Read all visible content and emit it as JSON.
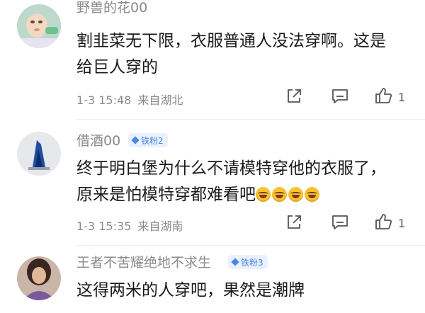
{
  "comments": [
    {
      "username": "野兽的花00",
      "badge": "",
      "line1": "割韭菜无下限，衣服普通人没法穿啊。这是",
      "line2": "给巨人穿的",
      "date": "1-3 15:48",
      "location": "来自湖北",
      "likes": "1"
    },
    {
      "username": "借酒00",
      "badge": "铁粉2",
      "line1": "终于明白堡为什么不请模特穿他的衣服了，",
      "line2": "原来是怕模特穿都难看吧",
      "emoji": [
        "laugh-cry-emoji",
        "laugh-cry-emoji",
        "laugh-cry-emoji",
        "laugh-cry-emoji"
      ],
      "date": "1-3 15:35",
      "location": "来自湖南",
      "likes": "1"
    },
    {
      "username": "王者不苦耀绝地不求生",
      "badge": "铁粉3",
      "line1": "这得两米的人穿吧，果然是潮牌"
    }
  ],
  "icons": {
    "share": "share-icon",
    "reply": "comment-icon",
    "like": "thumbs-up-icon"
  },
  "colors": {
    "badge_bg": "#eaf1fd",
    "badge_text": "#4a86e8",
    "meta_text": "#8a8a8a"
  }
}
